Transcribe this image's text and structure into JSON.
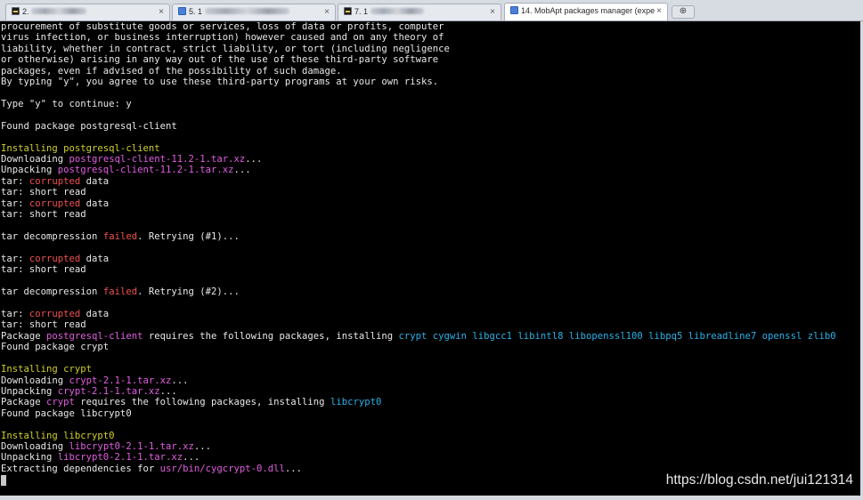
{
  "tabs": [
    {
      "label": "2.",
      "icon": "terminal-icon"
    },
    {
      "label": "5. 1",
      "icon": "session-icon"
    },
    {
      "label": "7. 1",
      "icon": "terminal-icon"
    },
    {
      "label": "14. MobApt packages manager (expe",
      "icon": "package-icon",
      "active": true
    }
  ],
  "close_glyph": "×",
  "new_tab_glyph": "⊕",
  "watermark": "https://blog.csdn.net/jui121314",
  "terminal": {
    "lines": [
      [
        {
          "t": "procurement of substitute goods or services, loss of data or profits, computer",
          "c": "white"
        }
      ],
      [
        {
          "t": "virus infection, or business interruption) however caused and on any theory of",
          "c": "white"
        }
      ],
      [
        {
          "t": "liability, whether in contract, strict liability, or tort (including negligence",
          "c": "white"
        }
      ],
      [
        {
          "t": "or otherwise) arising in any way out of the use of these third-party software",
          "c": "white"
        }
      ],
      [
        {
          "t": "packages, even if advised of the possibility of such damage.",
          "c": "white"
        }
      ],
      [
        {
          "t": "By typing \"y\", you agree to use these third-party programs at your own risks.",
          "c": "white"
        }
      ],
      [],
      [
        {
          "t": "Type \"y\" to continue: y",
          "c": "white"
        }
      ],
      [],
      [
        {
          "t": "Found package postgresql-client",
          "c": "white"
        }
      ],
      [],
      [
        {
          "t": "Installing postgresql-client",
          "c": "yellow"
        }
      ],
      [
        {
          "t": "Downloading ",
          "c": "white"
        },
        {
          "t": "postgresql-client-11.2-1.tar.xz",
          "c": "magenta"
        },
        {
          "t": "...",
          "c": "white"
        }
      ],
      [
        {
          "t": "Unpacking ",
          "c": "white"
        },
        {
          "t": "postgresql-client-11.2-1.tar.xz",
          "c": "magenta"
        },
        {
          "t": "...",
          "c": "white"
        }
      ],
      [
        {
          "t": "tar: ",
          "c": "white"
        },
        {
          "t": "corrupted",
          "c": "red"
        },
        {
          "t": " data",
          "c": "white"
        }
      ],
      [
        {
          "t": "tar: short read",
          "c": "white"
        }
      ],
      [
        {
          "t": "tar: ",
          "c": "white"
        },
        {
          "t": "corrupted",
          "c": "red"
        },
        {
          "t": " data",
          "c": "white"
        }
      ],
      [
        {
          "t": "tar: short read",
          "c": "white"
        }
      ],
      [],
      [
        {
          "t": "tar decompression ",
          "c": "white"
        },
        {
          "t": "failed",
          "c": "red"
        },
        {
          "t": ". Retrying (#1)...",
          "c": "white"
        }
      ],
      [],
      [
        {
          "t": "tar: ",
          "c": "white"
        },
        {
          "t": "corrupted",
          "c": "red"
        },
        {
          "t": " data",
          "c": "white"
        }
      ],
      [
        {
          "t": "tar: short read",
          "c": "white"
        }
      ],
      [],
      [
        {
          "t": "tar decompression ",
          "c": "white"
        },
        {
          "t": "failed",
          "c": "red"
        },
        {
          "t": ". Retrying (#2)...",
          "c": "white"
        }
      ],
      [],
      [
        {
          "t": "tar: ",
          "c": "white"
        },
        {
          "t": "corrupted",
          "c": "red"
        },
        {
          "t": " data",
          "c": "white"
        }
      ],
      [
        {
          "t": "tar: short read",
          "c": "white"
        }
      ],
      [
        {
          "t": "Package ",
          "c": "white"
        },
        {
          "t": "postgresql-client",
          "c": "magenta"
        },
        {
          "t": " requires the following packages, installing ",
          "c": "white"
        },
        {
          "t": "crypt cygwin libgcc1 libintl8 libopenssl100 libpq5 libreadline7 openssl zlib0",
          "c": "cyan"
        }
      ],
      [
        {
          "t": "Found package crypt",
          "c": "white"
        }
      ],
      [],
      [
        {
          "t": "Installing crypt",
          "c": "yellow"
        }
      ],
      [
        {
          "t": "Downloading ",
          "c": "white"
        },
        {
          "t": "crypt-2.1-1.tar.xz",
          "c": "magenta"
        },
        {
          "t": "...",
          "c": "white"
        }
      ],
      [
        {
          "t": "Unpacking ",
          "c": "white"
        },
        {
          "t": "crypt-2.1-1.tar.xz",
          "c": "magenta"
        },
        {
          "t": "...",
          "c": "white"
        }
      ],
      [
        {
          "t": "Package ",
          "c": "white"
        },
        {
          "t": "crypt",
          "c": "magenta"
        },
        {
          "t": " requires the following packages, installing ",
          "c": "white"
        },
        {
          "t": "libcrypt0",
          "c": "cyan"
        }
      ],
      [
        {
          "t": "Found package libcrypt0",
          "c": "white"
        }
      ],
      [],
      [
        {
          "t": "Installing libcrypt0",
          "c": "yellow"
        }
      ],
      [
        {
          "t": "Downloading ",
          "c": "white"
        },
        {
          "t": "libcrypt0-2.1-1.tar.xz",
          "c": "magenta"
        },
        {
          "t": "...",
          "c": "white"
        }
      ],
      [
        {
          "t": "Unpacking ",
          "c": "white"
        },
        {
          "t": "libcrypt0-2.1-1.tar.xz",
          "c": "magenta"
        },
        {
          "t": "...",
          "c": "white"
        }
      ],
      [
        {
          "t": "Extracting dependencies for ",
          "c": "white"
        },
        {
          "t": "usr/bin/cygcrypt-0.dll",
          "c": "magenta"
        },
        {
          "t": "...",
          "c": "white"
        }
      ]
    ]
  },
  "colors": {
    "terminal_bg": "#000000",
    "text_default": "#e8e8e8",
    "yellow": "#d1cf2c",
    "magenta": "#e25de2",
    "red": "#f05050",
    "cyan": "#29b2e8"
  }
}
